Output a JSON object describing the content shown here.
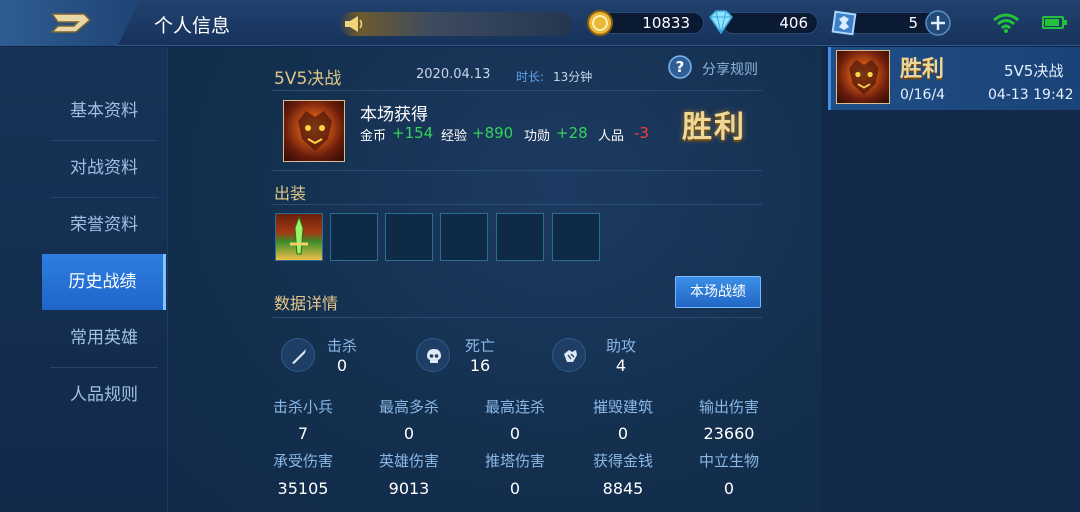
{
  "header": {
    "title": "个人信息",
    "resources": {
      "gold": "10833",
      "diamond": "406",
      "voucher": "5"
    }
  },
  "sidebar": {
    "items": [
      {
        "label": "基本资料",
        "active": false
      },
      {
        "label": "对战资料",
        "active": false
      },
      {
        "label": "荣誉资料",
        "active": false
      },
      {
        "label": "历史战绩",
        "active": true
      },
      {
        "label": "常用英雄",
        "active": false
      },
      {
        "label": "人品规则",
        "active": false
      }
    ]
  },
  "match": {
    "mode": "5V5决战",
    "date": "2020.04.13",
    "duration_label": "时长:",
    "duration": "13分钟",
    "share_label": "分享规则",
    "rewards_title": "本场获得",
    "rewards": {
      "gold_label": "金币",
      "gold": "+154",
      "exp_label": "经验",
      "exp": "+890",
      "merit_label": "功勋",
      "merit": "+28",
      "karma_label": "人品",
      "karma": "-3"
    },
    "result": "胜利",
    "equipment_title": "出装",
    "details_title": "数据详情",
    "details_button": "本场战绩",
    "kda": [
      {
        "label": "击杀",
        "value": "0",
        "icon": "sword-icon"
      },
      {
        "label": "死亡",
        "value": "16",
        "icon": "skull-icon"
      },
      {
        "label": "助攻",
        "value": "4",
        "icon": "gauntlet-icon"
      }
    ],
    "stats_row1": [
      {
        "label": "击杀小兵",
        "value": "7"
      },
      {
        "label": "最高多杀",
        "value": "0"
      },
      {
        "label": "最高连杀",
        "value": "0"
      },
      {
        "label": "摧毁建筑",
        "value": "0"
      },
      {
        "label": "输出伤害",
        "value": "23660"
      }
    ],
    "stats_row2": [
      {
        "label": "承受伤害",
        "value": "35105"
      },
      {
        "label": "英雄伤害",
        "value": "9013"
      },
      {
        "label": "推塔伤害",
        "value": "0"
      },
      {
        "label": "获得金钱",
        "value": "8845"
      },
      {
        "label": "中立生物",
        "value": "0"
      }
    ]
  },
  "history": [
    {
      "result": "胜利",
      "mode": "5V5决战",
      "kda": "0/16/4",
      "time": "04-13 19:42"
    }
  ],
  "colors": {
    "gold_text": "#e1c68a",
    "label_blue": "#85b4e6",
    "positive": "#33d35a",
    "negative": "#ff3b3b",
    "active_tab": "#2e7de0"
  }
}
